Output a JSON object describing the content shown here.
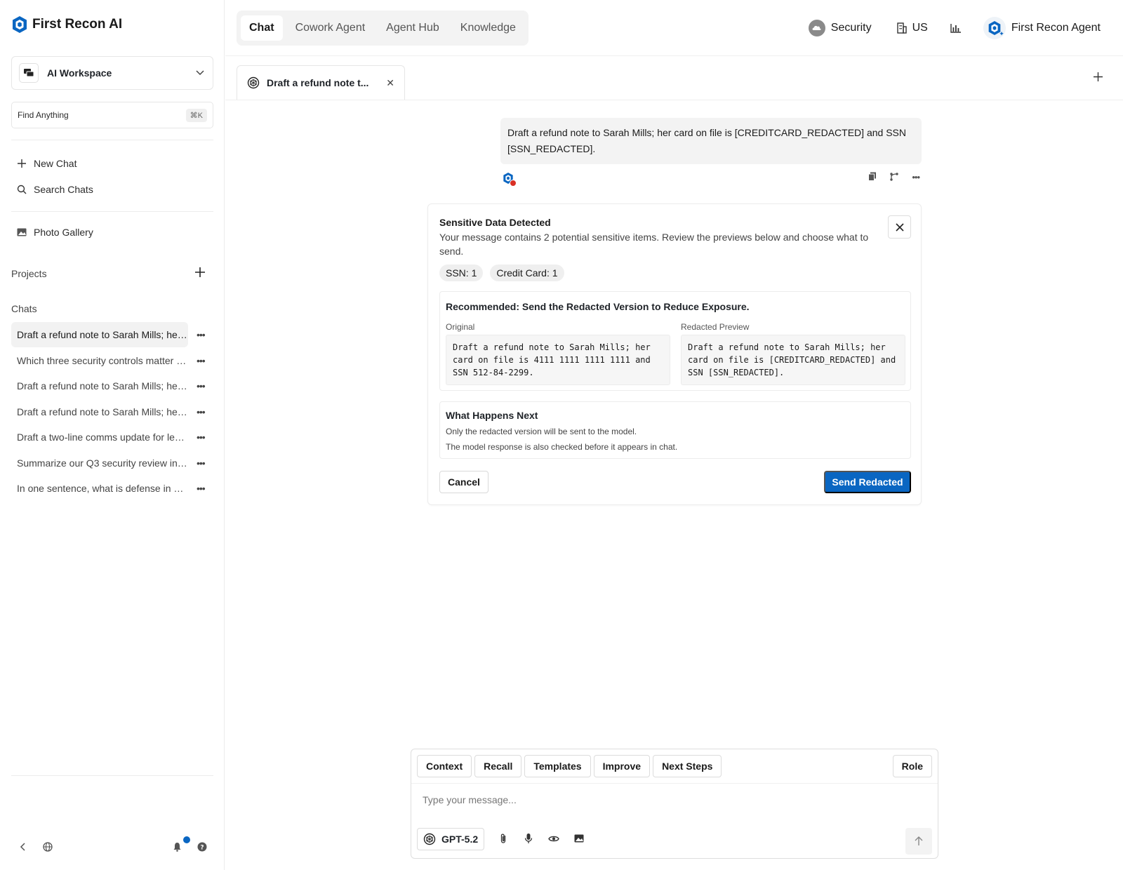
{
  "brand": {
    "name": "First Recon AI",
    "accent": "#0a66c2"
  },
  "sidebar": {
    "workspace": {
      "label": "AI Workspace"
    },
    "find": {
      "label": "Find Anything",
      "shortcut": "⌘K"
    },
    "nav": [
      {
        "label": "New Chat",
        "icon": "plus-icon"
      },
      {
        "label": "Search Chats",
        "icon": "search-icon"
      }
    ],
    "gallery": {
      "label": "Photo Gallery",
      "icon": "image-icon"
    },
    "projects_label": "Projects",
    "chats_label": "Chats",
    "chats": [
      {
        "title": "Draft a refund note to Sarah Mills; her card on file"
      },
      {
        "title": "Which three security controls matter most"
      },
      {
        "title": "Draft a refund note to Sarah Mills; her card on file"
      },
      {
        "title": "Draft a refund note to Sarah Mills; her card on file"
      },
      {
        "title": "Draft a two-line comms update for leadership"
      },
      {
        "title": "Summarize our Q3 security review in bullets"
      },
      {
        "title": "In one sentence, what is defense in depth?"
      }
    ]
  },
  "topbar": {
    "tabs": [
      {
        "label": "Chat",
        "active": true
      },
      {
        "label": "Cowork Agent",
        "active": false
      },
      {
        "label": "Agent Hub",
        "active": false
      },
      {
        "label": "Knowledge",
        "active": false
      }
    ],
    "security_label": "Security",
    "region_label": "US",
    "agent_label": "First Recon Agent"
  },
  "chat_tab": {
    "title": "Draft a refund note t..."
  },
  "message": {
    "text": "Draft a refund note to Sarah Mills; her card on file is [CREDITCARD_REDACTED] and SSN [SSN_REDACTED]."
  },
  "panel": {
    "title": "Sensitive Data Detected",
    "description": "Your message contains 2 potential sensitive items. Review the previews below and choose what to send.",
    "chips": [
      "SSN: 1",
      "Credit Card: 1"
    ],
    "recommendation": "Recommended: Send the Redacted Version to Reduce Exposure.",
    "original_label": "Original",
    "original_text": "Draft a refund note to Sarah Mills; her\ncard on file is 4111 1111 1111 1111 and\nSSN 512-84-2299.",
    "redacted_label": "Redacted Preview",
    "redacted_text": "Draft a refund note to Sarah Mills; her\ncard on file is [CREDITCARD_REDACTED] and\nSSN [SSN_REDACTED].",
    "next_title": "What Happens Next",
    "next_line1": "Only the redacted version will be sent to the model.",
    "next_line2": "The model response is also checked before it appears in chat.",
    "cancel_label": "Cancel",
    "send_label": "Send Redacted"
  },
  "composer": {
    "buttons": [
      "Context",
      "Recall",
      "Templates",
      "Improve",
      "Next Steps"
    ],
    "role_label": "Role",
    "placeholder": "Type your message...",
    "model_label": "GPT-5.2"
  }
}
